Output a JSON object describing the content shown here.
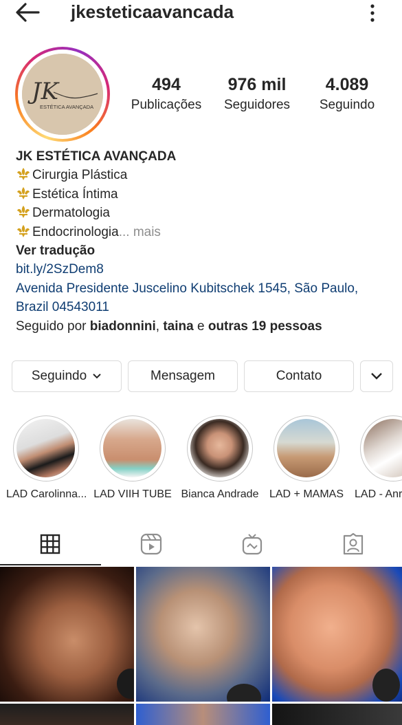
{
  "header": {
    "username": "jkesteticaavancada",
    "back_icon": "arrow-left-icon",
    "more_icon": "more-vertical-icon"
  },
  "profile": {
    "avatar_logo_monogram": "JK",
    "avatar_logo_text": "ESTÉTICA AVANÇADA",
    "stats": [
      {
        "value": "494",
        "label": "Publicações"
      },
      {
        "value": "976 mil",
        "label": "Seguidores"
      },
      {
        "value": "4.089",
        "label": "Seguindo"
      }
    ],
    "name": "JK ESTÉTICA AVANÇADA",
    "bio_lines": [
      "Cirurgia Plástica",
      "Estética Íntima",
      "Dermatologia",
      "Endocrinologia"
    ],
    "bio_more": "... mais",
    "translate": "Ver tradução",
    "website": "bit.ly/2SzDem8",
    "address_line1": "Avenida Presidente Juscelino Kubitschek 1545, São Paulo,",
    "address_line2": "Brazil 04543011",
    "followed_prefix": "Seguido por ",
    "followed_user1": "biadonnini",
    "followed_sep": ", ",
    "followed_user2": "taina",
    "followed_and": " e ",
    "followed_others": "outras 19 pessoas"
  },
  "actions": {
    "following": "Seguindo",
    "message": "Mensagem",
    "contact": "Contato"
  },
  "highlights": [
    {
      "label": "LAD Carolinna..."
    },
    {
      "label": "LAD VIIH TUBE"
    },
    {
      "label": "Bianca Andrade"
    },
    {
      "label": "LAD + MAMAS"
    },
    {
      "label": "LAD - Anr"
    }
  ],
  "tabs": [
    {
      "icon": "grid-icon",
      "active": true
    },
    {
      "icon": "reels-icon",
      "active": false
    },
    {
      "icon": "igtv-icon",
      "active": false
    },
    {
      "icon": "tagged-icon",
      "active": false
    }
  ],
  "colors": {
    "link": "#0f3d72",
    "muted": "#8e8e8e",
    "text": "#262626",
    "border": "#dbdbdb"
  }
}
